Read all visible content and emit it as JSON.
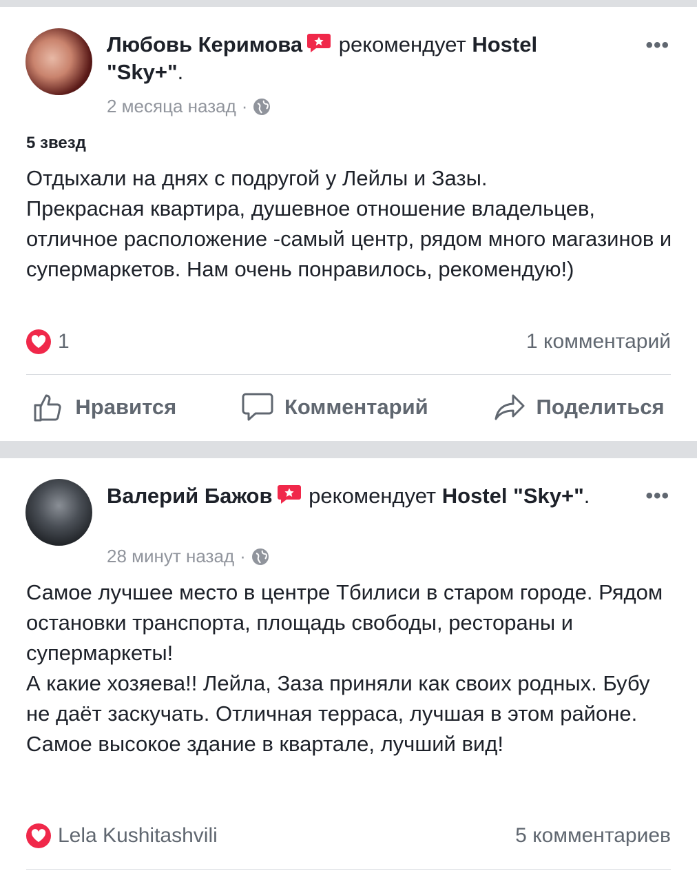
{
  "posts": [
    {
      "author": "Любовь Керимова",
      "verb": "рекомендует",
      "page_name": "Hostel \"Sky+\"",
      "time": "2 месяца назад",
      "rating": "5 звезд",
      "text": "Отдыхали на днях с подругой у Лейлы и Зазы.\nПрекрасная  квартира, душевное отношение владельцев,  отличное расположение -самый центр, рядом много магазинов и супермаркетов. Нам очень понравилось,  рекомендую!)",
      "reaction_count": "1",
      "comments": "1 комментарий",
      "actions": {
        "like": "Нравится",
        "comment": "Комментарий",
        "share": "Поделиться"
      }
    },
    {
      "author": "Валерий Бажов",
      "verb": "рекомендует",
      "page_name": "Hostel \"Sky+\"",
      "time": "28 минут назад",
      "text": "Самое лучшее место в центре Тбилиси в старом городе. Рядом остановки транспорта, площадь свободы, рестораны и супермаркеты!\nА какие хозяева!! Лейла, Заза приняли как своих родных. Бубу не даёт заскучать. Отличная терраса, лучшая в этом районе. Самое высокое здание в квартале, лучший вид!",
      "reaction_name": "Lela Kushitashvili",
      "comments": "5 комментариев"
    }
  ],
  "colors": {
    "separator": "#dddfe2",
    "heart": "#f0284a",
    "meta": "#90949c",
    "action": "#606770"
  }
}
